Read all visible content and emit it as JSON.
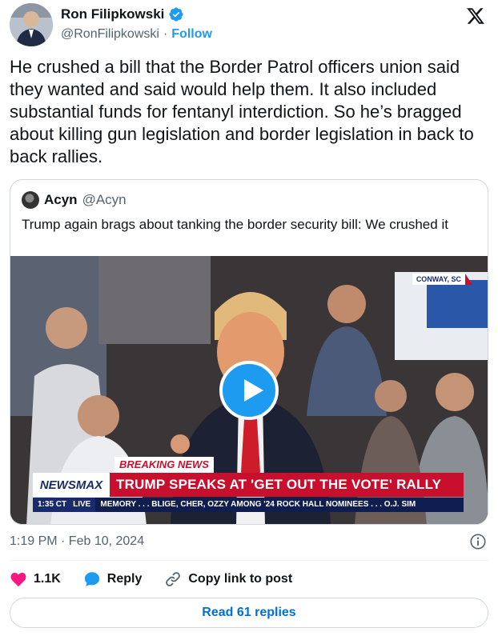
{
  "author": {
    "display_name": "Ron Filipkowski",
    "handle": "@RonFilipkowski",
    "separator": "·",
    "follow_label": "Follow"
  },
  "tweet": {
    "text": "He crushed a bill that the Border Patrol officers union said they wanted and said would help them. It also included substantial funds for fentanyl interdiction. So he’s bragged about killing gun legislation and border legislation in back to back rallies."
  },
  "quote": {
    "display_name": "Acyn",
    "handle": "@Acyn",
    "text": "Trump again brags about tanking the border security bill: We crushed it",
    "video": {
      "location_tag": "CONWAY, SC",
      "breaking_label": "BREAKING NEWS",
      "network": "NEWSMAX",
      "headline": "TRUMP SPEAKS AT 'GET OUT THE VOTE' RALLY",
      "ticker_time": "1:35 CT",
      "ticker_live": "LIVE",
      "ticker_text": "MEMORY . . .    BLIGE, CHER, OZZY AMONG '24 ROCK HALL NOMINEES . . .    O.J. SIM"
    }
  },
  "meta": {
    "timestamp": "1:19 PM · Feb 10, 2024"
  },
  "actions": {
    "likes": "1.1K",
    "reply_label": "Reply",
    "copy_label": "Copy link to post"
  },
  "read_replies_label": "Read 61 replies",
  "colors": {
    "accent": "#1d9bf0",
    "like": "#f91880",
    "newsmax_red": "#c8102e",
    "newsmax_navy": "#1a2b6d"
  },
  "icons": [
    "verified-badge-icon",
    "x-logo-icon",
    "info-icon",
    "heart-icon",
    "reply-bubble-icon",
    "link-icon",
    "play-icon"
  ]
}
